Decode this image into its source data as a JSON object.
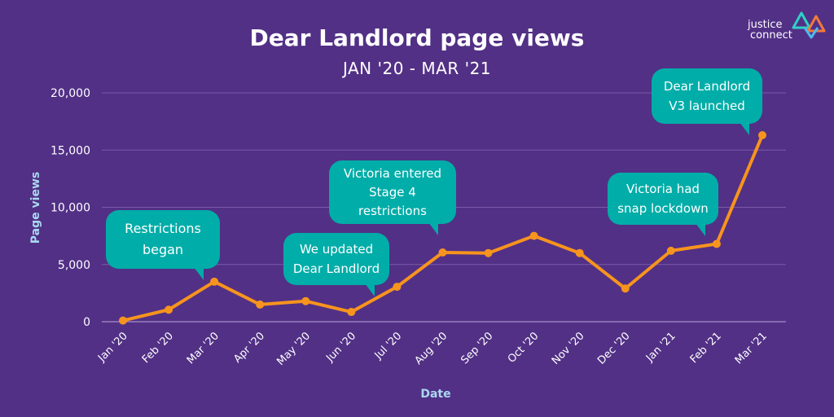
{
  "header": {
    "title": "Dear Landlord page views",
    "subtitle": "JAN '20 - MAR '21"
  },
  "logo": {
    "line1": "justice",
    "line2": "connect",
    "colors": {
      "teal": "#2ED1C6",
      "orange": "#F27A3B",
      "blue": "#4FB7F0"
    }
  },
  "colors": {
    "background": "#523086",
    "line": "#F7941D",
    "gridline": "#7A5AA8",
    "axis_label": "#A9D8F0",
    "bubble": "#00ADA8",
    "text": "#FFFFFF"
  },
  "chart_data": {
    "type": "line",
    "title": "Dear Landlord page views",
    "subtitle": "JAN '20 - MAR '21",
    "xlabel": "Date",
    "ylabel": "Page views",
    "ylim": [
      0,
      20000
    ],
    "yticks": [
      0,
      5000,
      10000,
      15000,
      20000
    ],
    "ytick_labels": [
      "0",
      "5,000",
      "10,000",
      "15,000",
      "20,000"
    ],
    "grid": true,
    "categories": [
      "Jan '20",
      "Feb '20",
      "Mar '20",
      "Apr '20",
      "May '20",
      "Jun '20",
      "Jul '20",
      "Aug '20",
      "Sep '20",
      "Oct '20",
      "Nov '20",
      "Dec '20",
      "Jan '21",
      "Feb '21",
      "Mar '21"
    ],
    "series": [
      {
        "name": "Page views",
        "values": [
          100,
          1050,
          3500,
          1500,
          1800,
          850,
          3050,
          6050,
          6000,
          7500,
          6000,
          2900,
          6200,
          6800,
          16300
        ]
      }
    ],
    "annotations": [
      {
        "text": [
          "Restrictions",
          "began"
        ],
        "category": "Mar '20"
      },
      {
        "text": [
          "We updated",
          "Dear Landlord"
        ],
        "category": "Jun '20"
      },
      {
        "text": [
          "Victoria entered",
          "Stage 4",
          "restrictions"
        ],
        "category": "Jul '20"
      },
      {
        "text": [
          "Victoria had",
          "snap lockdown"
        ],
        "category": "Feb '21"
      },
      {
        "text": [
          "Dear Landlord",
          "V3 launched"
        ],
        "category": "Mar '21"
      }
    ]
  }
}
